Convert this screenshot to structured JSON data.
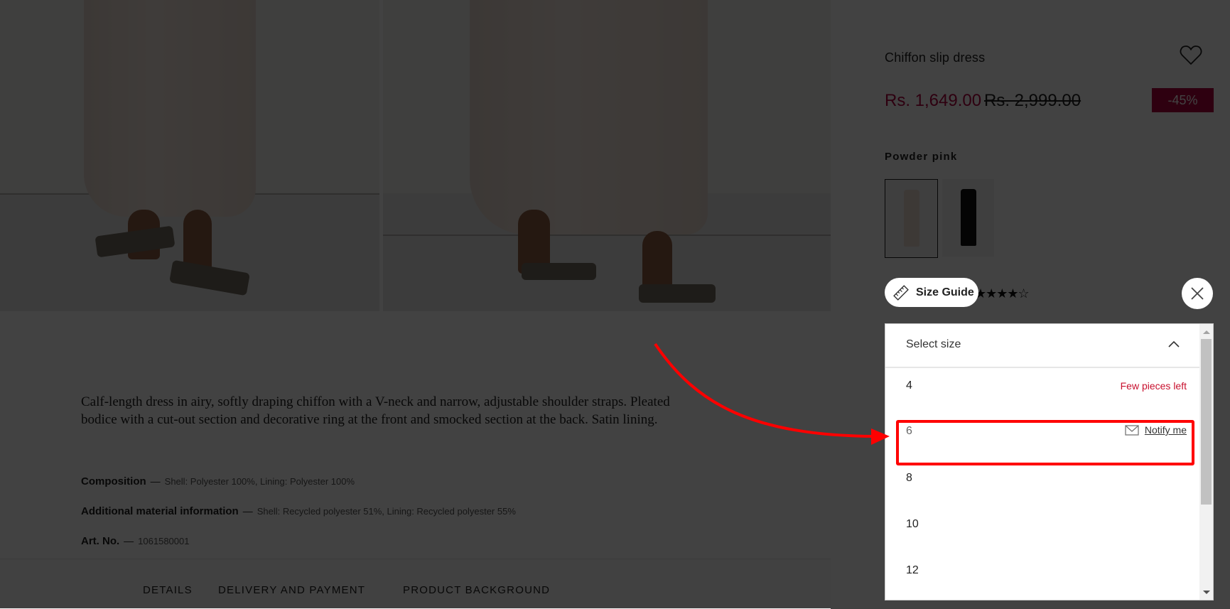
{
  "product": {
    "title": "Chiffon slip dress",
    "price_current": "Rs. 1,649.00",
    "price_original": "Rs. 2,999.00",
    "discount_badge": "-45%",
    "color_name": "Powder pink",
    "swatches": [
      {
        "name": "Powder pink",
        "selected": true,
        "color": "#eadcd2"
      },
      {
        "name": "Black",
        "selected": false,
        "color": "#111111"
      }
    ],
    "rating_stars": "★★★★☆",
    "rating_value": 4,
    "rating_max": 5,
    "description": "Calf-length dress in airy, softly draping chiffon with a V-neck and narrow, adjustable shoulder straps. Pleated bodice with a cut-out section and decorative ring at the front and smocked section at the back. Satin lining.",
    "specs": [
      {
        "label": "Composition",
        "value": "Shell: Polyester 100%, Lining: Polyester 100%"
      },
      {
        "label": "Additional material information",
        "value": "Shell: Recycled polyester 51%, Lining: Recycled polyester 55%"
      },
      {
        "label": "Art. No.",
        "value": "1061580001"
      }
    ],
    "dash": "—"
  },
  "tabs": [
    "DETAILS",
    "DELIVERY AND PAYMENT",
    "PRODUCT BACKGROUND"
  ],
  "size_guide": {
    "label": "Size Guide",
    "icon": "ruler-icon"
  },
  "size_dropdown": {
    "label": "Select size",
    "expanded": true,
    "options": [
      {
        "size": "4",
        "status": "Few pieces left",
        "available": true
      },
      {
        "size": "6",
        "status": "Notify me",
        "available": false
      },
      {
        "size": "8",
        "status": "",
        "available": true
      },
      {
        "size": "10",
        "status": "",
        "available": true
      },
      {
        "size": "12",
        "status": "",
        "available": true
      }
    ]
  },
  "annotation": {
    "highlight_target": "size option 6",
    "color": "#ff0000"
  },
  "colors": {
    "sale_red": "#b0003f",
    "stock_warning": "#c8102e",
    "overlay": "#414141"
  }
}
